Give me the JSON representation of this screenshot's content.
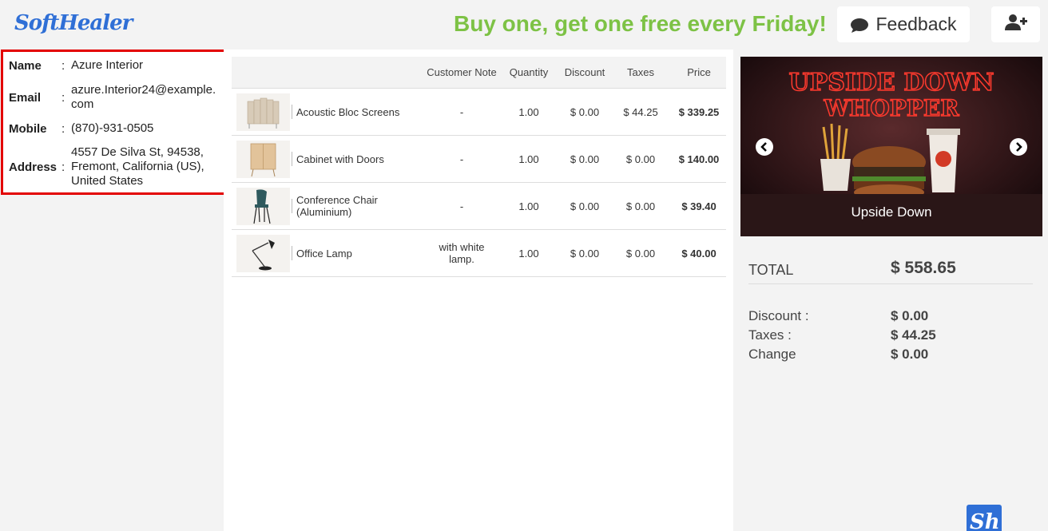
{
  "header": {
    "logo_text": "SoftHealer",
    "promo": "Buy one, get one free every Friday!",
    "feedback_label": "Feedback",
    "feedback_icon": "chat-bubble-icon",
    "add_user_icon": "user-plus-icon"
  },
  "customer": {
    "name_label": "Name",
    "name": "Azure Interior",
    "email_label": "Email",
    "email": "azure.Interior24@example.com",
    "mobile_label": "Mobile",
    "mobile": "(870)-931-0505",
    "address_label": "Address",
    "address": "4557 De Silva St, 94538, Fremont, California (US), United States",
    "separator": ":"
  },
  "order_table": {
    "columns": [
      "Customer Note",
      "Quantity",
      "Discount",
      "Taxes",
      "Price"
    ],
    "rows": [
      {
        "product": "Acoustic Bloc Screens",
        "note": "-",
        "quantity": "1.00",
        "discount": "$ 0.00",
        "taxes": "$ 44.25",
        "price": "$ 339.25"
      },
      {
        "product": "Cabinet with Doors",
        "note": "-",
        "quantity": "1.00",
        "discount": "$ 0.00",
        "taxes": "$ 0.00",
        "price": "$ 140.00"
      },
      {
        "product": "Conference Chair (Aluminium)",
        "note": "-",
        "quantity": "1.00",
        "discount": "$ 0.00",
        "taxes": "$ 0.00",
        "price": "$ 39.40"
      },
      {
        "product": "Office Lamp",
        "note": "with white lamp.",
        "quantity": "1.00",
        "discount": "$ 0.00",
        "taxes": "$ 0.00",
        "price": "$ 40.00"
      }
    ]
  },
  "banner": {
    "title_line1": "UPSIDE DOWN",
    "title_line2": "WHOPPER",
    "caption": "Upside Down"
  },
  "summary": {
    "total_label": "TOTAL",
    "total": "$ 558.65",
    "discount_label": "Discount :",
    "discount": "$ 0.00",
    "taxes_label": "Taxes :",
    "taxes": "$ 44.25",
    "change_label": "Change",
    "change": "$ 0.00"
  },
  "colors": {
    "brand_blue": "#2f6fd6",
    "promo_green": "#7dc245",
    "highlight_red": "#e30000"
  }
}
